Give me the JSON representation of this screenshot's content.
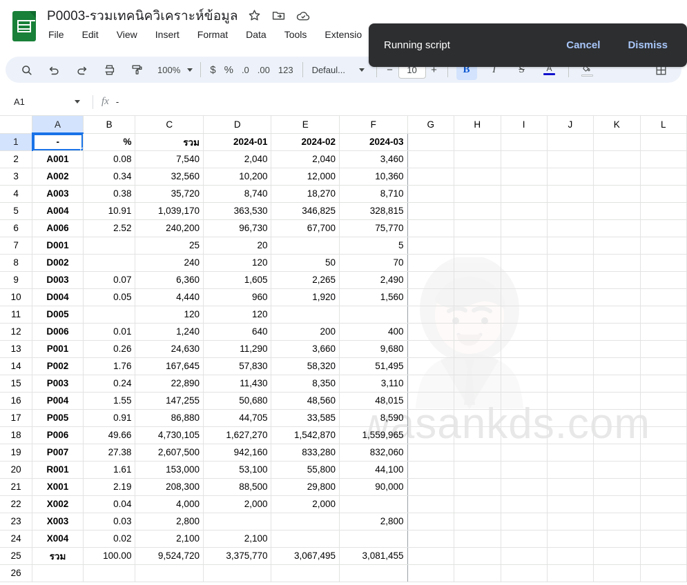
{
  "app": {
    "doc_title": "P0003-รวมเทคนิควิเคราะห์ข้อมูล",
    "doc_icon": "sheets-icon",
    "header_icons": [
      {
        "name": "star-icon",
        "label": "Star"
      },
      {
        "name": "move-to-folder-icon",
        "label": "Move"
      },
      {
        "name": "cloud-saved-icon",
        "label": "Saved to Drive"
      }
    ]
  },
  "menubar": {
    "items": [
      {
        "label": "File"
      },
      {
        "label": "Edit"
      },
      {
        "label": "View"
      },
      {
        "label": "Insert"
      },
      {
        "label": "Format"
      },
      {
        "label": "Data"
      },
      {
        "label": "Tools"
      },
      {
        "label": "Extensio"
      }
    ]
  },
  "toolbar": {
    "search_icon": "search-icon",
    "undo_icon": "undo-icon",
    "redo_icon": "redo-icon",
    "print_icon": "print-icon",
    "paint_format_icon": "paint-format-icon",
    "zoom_level": "100%",
    "currency_label": "$",
    "percent_label": "%",
    "decrease_decimal_label": ".0",
    "increase_decimal_label": ".00",
    "more_formats_label": "123",
    "font_name": "Defaul...",
    "font_size": "10",
    "decrease_font_label": "−",
    "increase_font_label": "+",
    "bold_label": "B",
    "italic_label": "I",
    "strikethrough_label": "S",
    "text_color_label": "A",
    "text_color_value": "#1111cc",
    "fill_color_value": "#ffffff",
    "borders_icon": "borders-icon"
  },
  "toast": {
    "message": "Running script",
    "cancel_label": "Cancel",
    "dismiss_label": "Dismiss",
    "background": "#2d2e30",
    "action_color": "#a8c7fa"
  },
  "formula_bar": {
    "name_box": "A1",
    "fx_label": "fx",
    "value": "-"
  },
  "watermark": {
    "text": "wasankds.com"
  },
  "sheet": {
    "selected_cell": "A1",
    "selected_column": "A",
    "selected_row": "1",
    "column_headers": [
      "A",
      "B",
      "C",
      "D",
      "E",
      "F",
      "G",
      "H",
      "I",
      "J",
      "K",
      "L"
    ],
    "row_numbers": [
      "1",
      "2",
      "3",
      "4",
      "5",
      "6",
      "7",
      "8",
      "9",
      "10",
      "11",
      "12",
      "13",
      "14",
      "15",
      "16",
      "17",
      "18",
      "19",
      "20",
      "21",
      "22",
      "23",
      "24",
      "25",
      "26"
    ],
    "header_row": {
      "A": "-",
      "B": "%",
      "C": "รวม",
      "D": "2024-01",
      "E": "2024-02",
      "F": "2024-03"
    },
    "rows": [
      {
        "row": "2",
        "A": "A001",
        "B": "0.08",
        "C": "7,540",
        "D": "2,040",
        "E": "2,040",
        "F": "3,460"
      },
      {
        "row": "3",
        "A": "A002",
        "B": "0.34",
        "C": "32,560",
        "D": "10,200",
        "E": "12,000",
        "F": "10,360"
      },
      {
        "row": "4",
        "A": "A003",
        "B": "0.38",
        "C": "35,720",
        "D": "8,740",
        "E": "18,270",
        "F": "8,710"
      },
      {
        "row": "5",
        "A": "A004",
        "B": "10.91",
        "C": "1,039,170",
        "D": "363,530",
        "E": "346,825",
        "F": "328,815"
      },
      {
        "row": "6",
        "A": "A006",
        "B": "2.52",
        "C": "240,200",
        "D": "96,730",
        "E": "67,700",
        "F": "75,770"
      },
      {
        "row": "7",
        "A": "D001",
        "B": "",
        "C": "25",
        "D": "20",
        "E": "",
        "F": "5"
      },
      {
        "row": "8",
        "A": "D002",
        "B": "",
        "C": "240",
        "D": "120",
        "E": "50",
        "F": "70"
      },
      {
        "row": "9",
        "A": "D003",
        "B": "0.07",
        "C": "6,360",
        "D": "1,605",
        "E": "2,265",
        "F": "2,490"
      },
      {
        "row": "10",
        "A": "D004",
        "B": "0.05",
        "C": "4,440",
        "D": "960",
        "E": "1,920",
        "F": "1,560"
      },
      {
        "row": "11",
        "A": "D005",
        "B": "",
        "C": "120",
        "D": "120",
        "E": "",
        "F": ""
      },
      {
        "row": "12",
        "A": "D006",
        "B": "0.01",
        "C": "1,240",
        "D": "640",
        "E": "200",
        "F": "400"
      },
      {
        "row": "13",
        "A": "P001",
        "B": "0.26",
        "C": "24,630",
        "D": "11,290",
        "E": "3,660",
        "F": "9,680"
      },
      {
        "row": "14",
        "A": "P002",
        "B": "1.76",
        "C": "167,645",
        "D": "57,830",
        "E": "58,320",
        "F": "51,495"
      },
      {
        "row": "15",
        "A": "P003",
        "B": "0.24",
        "C": "22,890",
        "D": "11,430",
        "E": "8,350",
        "F": "3,110"
      },
      {
        "row": "16",
        "A": "P004",
        "B": "1.55",
        "C": "147,255",
        "D": "50,680",
        "E": "48,560",
        "F": "48,015"
      },
      {
        "row": "17",
        "A": "P005",
        "B": "0.91",
        "C": "86,880",
        "D": "44,705",
        "E": "33,585",
        "F": "8,590"
      },
      {
        "row": "18",
        "A": "P006",
        "B": "49.66",
        "C": "4,730,105",
        "D": "1,627,270",
        "E": "1,542,870",
        "F": "1,559,965"
      },
      {
        "row": "19",
        "A": "P007",
        "B": "27.38",
        "C": "2,607,500",
        "D": "942,160",
        "E": "833,280",
        "F": "832,060"
      },
      {
        "row": "20",
        "A": "R001",
        "B": "1.61",
        "C": "153,000",
        "D": "53,100",
        "E": "55,800",
        "F": "44,100"
      },
      {
        "row": "21",
        "A": "X001",
        "B": "2.19",
        "C": "208,300",
        "D": "88,500",
        "E": "29,800",
        "F": "90,000"
      },
      {
        "row": "22",
        "A": "X002",
        "B": "0.04",
        "C": "4,000",
        "D": "2,000",
        "E": "2,000",
        "F": ""
      },
      {
        "row": "23",
        "A": "X003",
        "B": "0.03",
        "C": "2,800",
        "D": "",
        "E": "",
        "F": "2,800"
      },
      {
        "row": "24",
        "A": "X004",
        "B": "0.02",
        "C": "2,100",
        "D": "2,100",
        "E": "",
        "F": ""
      },
      {
        "row": "25",
        "A": "รวม",
        "B": "100.00",
        "C": "9,524,720",
        "D": "3,375,770",
        "E": "3,067,495",
        "F": "3,081,455"
      },
      {
        "row": "26",
        "A": "",
        "B": "",
        "C": "",
        "D": "",
        "E": "",
        "F": ""
      }
    ]
  }
}
